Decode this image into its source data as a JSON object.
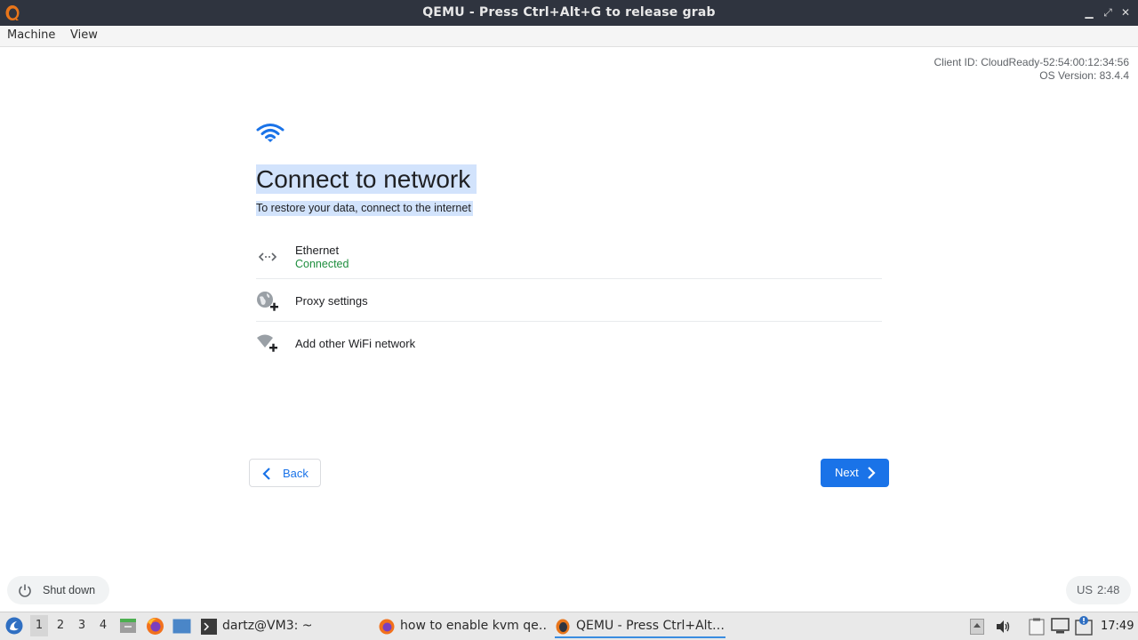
{
  "window": {
    "title": "QEMU - Press Ctrl+Alt+G to release grab",
    "minimize": "▁",
    "maximize": "⤢",
    "close": "✕"
  },
  "menubar": {
    "machine": "Machine",
    "view": "View"
  },
  "guest": {
    "client_id": "Client ID: CloudReady-52:54:00:12:34:56",
    "os_version": "OS Version: 83.4.4",
    "heading": "Connect to network",
    "subheading": "To restore your data, connect to the internet",
    "networks": [
      {
        "label": "Ethernet",
        "status": "Connected",
        "icon": "ethernet-icon"
      },
      {
        "label": "Proxy settings",
        "icon": "globe-plus-icon"
      },
      {
        "label": "Add other WiFi network",
        "icon": "wifi-plus-icon"
      }
    ],
    "back_label": "Back",
    "next_label": "Next",
    "shutdown_label": "Shut down",
    "keyboard_layout": "US",
    "guest_time": "2:48",
    "colors": {
      "accent": "#1a73e8",
      "selection": "#d2e3fc",
      "connected": "#1e8e3e"
    }
  },
  "taskbar": {
    "workspaces": [
      "1",
      "2",
      "3",
      "4"
    ],
    "active_workspace": "1",
    "tasks": [
      {
        "label": "dartz@VM3: ~",
        "icon": "terminal-icon"
      },
      {
        "label": "how to enable kvm qe…",
        "icon": "firefox-icon"
      },
      {
        "label": "QEMU - Press Ctrl+Alt…",
        "icon": "qemu-icon"
      }
    ],
    "clock": "17:49"
  }
}
